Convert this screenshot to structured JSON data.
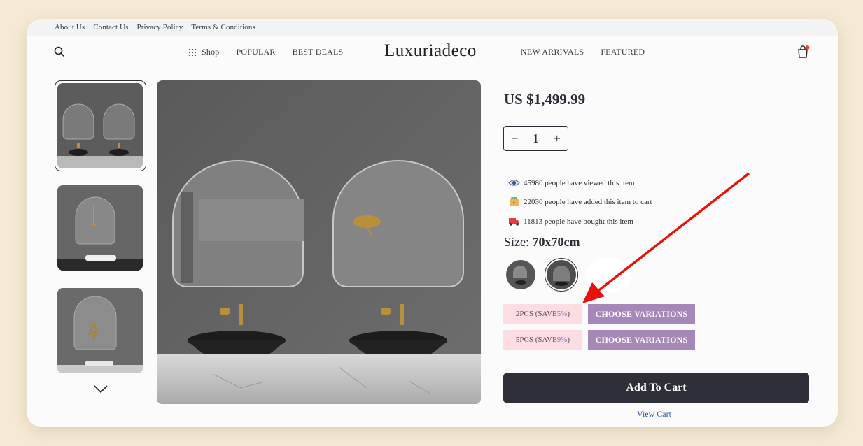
{
  "topbar": {
    "links": [
      "About Us",
      "Contact Us",
      "Privacy Policy",
      "Terms & Conditions"
    ]
  },
  "header": {
    "brand": "Luxuriadeco",
    "nav_left": [
      "Shop",
      "POPULAR",
      "BEST DEALS"
    ],
    "nav_right": [
      "NEW ARRIVALS",
      "FEATURED"
    ],
    "icons": [
      "search-icon",
      "grid-icon",
      "shopping-bag-icon"
    ],
    "cart_badge_color": "#e0453a"
  },
  "product": {
    "price": "US $1,499.99",
    "quantity": "1",
    "qty_minus": "−",
    "qty_plus": "+",
    "stats": [
      {
        "icon": "eye-icon",
        "text": "45980 people have viewed this item"
      },
      {
        "icon": "cart-box-icon",
        "text": "22030 people have added this item to cart"
      },
      {
        "icon": "truck-icon",
        "text": "11813 people have bought this item"
      }
    ],
    "size_label": "Size:",
    "size_value": "70x70cm",
    "bundles": [
      {
        "save_prefix": "2PCS (SAVE ",
        "save_pct": "5%",
        "save_suffix": ")",
        "choose": "CHOOSE VARIATIONS"
      },
      {
        "save_prefix": "5PCS (SAVE ",
        "save_pct": "9%",
        "save_suffix": ")",
        "choose": "CHOOSE VARIATIONS"
      }
    ],
    "add_to_cart": "Add To Cart",
    "view_cart": "View Cart"
  },
  "colors": {
    "accent_purple": "#a587b8",
    "save_pink": "#fbdde3",
    "button_dark": "#2e2f38",
    "annotation_arrow": "#e8120c"
  }
}
